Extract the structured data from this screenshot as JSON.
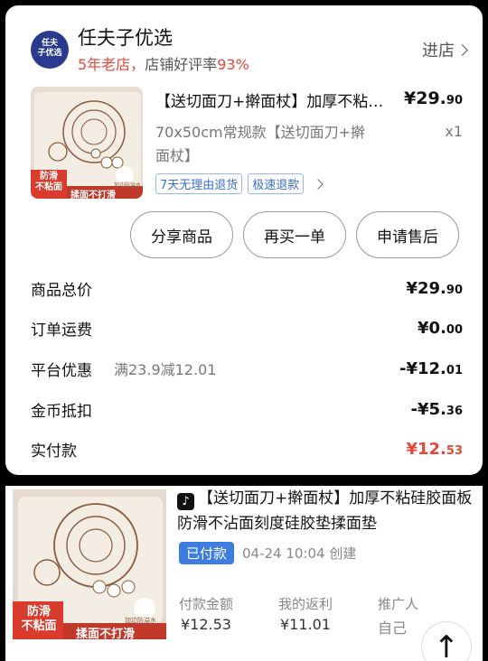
{
  "store": {
    "logo_text": "任夫\n子优选",
    "name": "任夫子优选",
    "years": "5年老店，",
    "rating_text": "店铺好评率",
    "rating_value": "93%",
    "enter_label": "进店"
  },
  "product": {
    "title": "【送切面刀+擀面杖】加厚不粘硅胶面板防滑不沾面刻度硅胶垫揉面垫",
    "price_main": "¥29.",
    "price_cents": "90",
    "spec": "70x50cm常规款【送切面刀+擀面杖】",
    "qty": "x1",
    "tags": [
      "7天无理由退货",
      "极速退款"
    ],
    "img_badge_1": "防滑\n不粘面",
    "img_badge_2": "揉面不打滑",
    "img_badge_small": "加边防溢水"
  },
  "actions": {
    "share": "分享商品",
    "rebuy": "再买一单",
    "aftersale": "申请售后"
  },
  "summary": {
    "total_label": "商品总价",
    "total_main": "¥29.",
    "total_cents": "90",
    "shipping_label": "订单运费",
    "shipping_main": "¥0.",
    "shipping_cents": "00",
    "discount_label": "平台优惠",
    "discount_note": "满23.9减12.01",
    "discount_main": "-¥12.",
    "discount_cents": "01",
    "coin_label": "金币抵扣",
    "coin_main": "-¥5.",
    "coin_cents": "36",
    "paid_label": "实付款",
    "paid_main": "¥12.",
    "paid_cents": "53"
  },
  "order2": {
    "app_icon": "♪",
    "title": "【送切面刀+擀面杖】加厚不粘硅胶面板防滑不沾面刻度硅胶垫揉面垫",
    "status": "已付款",
    "created": "04-24 10:04 创建",
    "paid_label": "付款金额",
    "paid_value": "¥12.53",
    "rebate_label": "我的返利",
    "rebate_value": "¥11.01",
    "promoter_label": "推广人",
    "promoter_value": "自己",
    "fab_icon": "↑"
  },
  "colors": {
    "accent_red": "#e5483a",
    "badge_blue": "#3d7de0",
    "tag_blue": "#3a6fd0",
    "store_logo": "#2a3b8f"
  }
}
